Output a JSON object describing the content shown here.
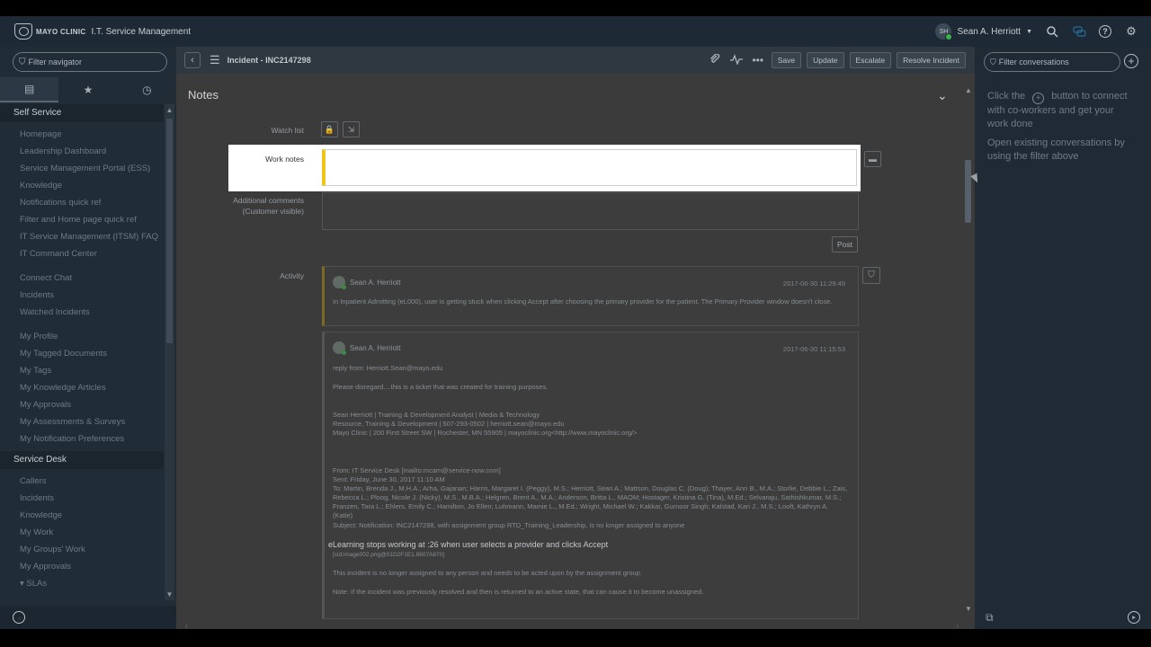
{
  "header": {
    "brand_name": "MAYO CLINIC",
    "app_title": "I.T. Service Management",
    "user_initials": "SH",
    "user_name": "Sean A. Herriott"
  },
  "nav": {
    "filter_placeholder": "Filter navigator",
    "tabs": [
      {
        "icon": "inbox-icon",
        "active": true
      },
      {
        "icon": "star-icon",
        "active": false
      },
      {
        "icon": "history-icon",
        "active": false
      }
    ],
    "sections": {
      "self_service": "Self Service",
      "service_desk": "Service Desk"
    },
    "self_service_items": [
      "Homepage",
      "Leadership Dashboard",
      "Service Management Portal (ESS)",
      "Knowledge",
      "Notifications quick ref",
      "Filter and Home page quick ref",
      "IT Service Management (ITSM) FAQ",
      "IT Command Center",
      "Connect Chat",
      "Incidents",
      "Watched Incidents",
      "My Profile",
      "My Tagged Documents",
      "My Tags",
      "My Knowledge Articles",
      "My Approvals",
      "My Assessments & Surveys",
      "My Notification Preferences"
    ],
    "service_desk_items": [
      "Callers",
      "Incidents",
      "Knowledge",
      "My Work",
      "My Groups' Work",
      "My Approvals",
      "▾ SLAs"
    ]
  },
  "form": {
    "title": "Incident - INC2147298",
    "buttons": {
      "save": "Save",
      "update": "Update",
      "escalate": "Escalate",
      "resolve": "Resolve Incident"
    },
    "section_title": "Notes",
    "labels": {
      "watch_list": "Watch list",
      "work_notes": "Work notes",
      "additional_comments_1": "Additional comments",
      "additional_comments_2": "(Customer visible)",
      "activity": "Activity"
    },
    "post_button": "Post"
  },
  "activity": [
    {
      "author": "Sean A. Herriott",
      "timestamp": "2017-06-30 11:29:49",
      "text": "In Inpatient Admitting (eL000), user is getting stuck when clicking Accept after choosing the primary provider for the patient. The Primary Provider window doesn't close."
    },
    {
      "author": "Sean A. Herriott",
      "timestamp": "2017-06-30 11:15:53",
      "reply_from": "reply from: Herriott.Sean@mayo.edu",
      "line1": "Please disregard....this is a ticket that was created for training purposes.",
      "sig1": "Sean Herriott | Training & Development Analyst | Media & Technology",
      "sig2": "Resource, Training & Development | 507-293-0502 | herriott.sean@mayo.edu",
      "sig3": "Mayo Clinic | 200 First Street SW | Rochester, MN 55905 | mayoclinic.org<http://www.mayoclinic.org/>",
      "from": "From: IT Service Desk [mailto:mcam@service-now.com]",
      "sent": "Sent: Friday, June 30, 2017 11:10 AM",
      "to": "To: Martin, Brenda J., M.H.A.; Arha, Gajanan; Harris, Margaret I. (Peggy), M.S.; Herriott, Sean A.; Mattson, Douglas C. (Doug); Thayer, Ann B., M.A.; Storlie, Debbie L.; Zais, Rebecca L.; Ploog, Nicole J. (Nicky), M.S., M.B.A.; Helgren, Brent A., M.A.; Anderson, Britta L., MAOM; Hostager, Kristina G. (Tina), M.Ed.; Selvaraju, Sathishkumar, M.S.; Franzen, Tara L.; Ehlers, Emily C.; Hamilton, Jo Ellen; Luhmann, Mamie L., M.Ed.; Wright, Michael W.; Kakkar, Gurnoor Singh; Kalstad, Kari J., M.S.; Looft, Kathryn A. (Katie)",
      "subject": "Subject: Notification: INC2147298, with assignment group RTD_Training_Leadership, is no longer assigned to anyone",
      "headline": "eLearning stops working at :26 when user selects a provider and clicks Accept",
      "image_ref": "[cid:image002.png@01D2F1E1.8807A870]",
      "body1": "This incident is no longer assigned to any person and needs to be acted upon by the assignment group.",
      "body2": "Note: If the incident was previously resolved and then is returned to an active state, that can cause it to become unassigned."
    }
  ],
  "conversations": {
    "filter_placeholder": "Filter conversations",
    "help_prefix": "Click the",
    "help_suffix": "button to connect with co-workers and get your work done",
    "help2": "Open existing conversations by using the filter above"
  },
  "colors": {
    "work_notes_accent": "#f0c419",
    "topbar": "#1d2a35",
    "nav_bg": "#202c36"
  }
}
